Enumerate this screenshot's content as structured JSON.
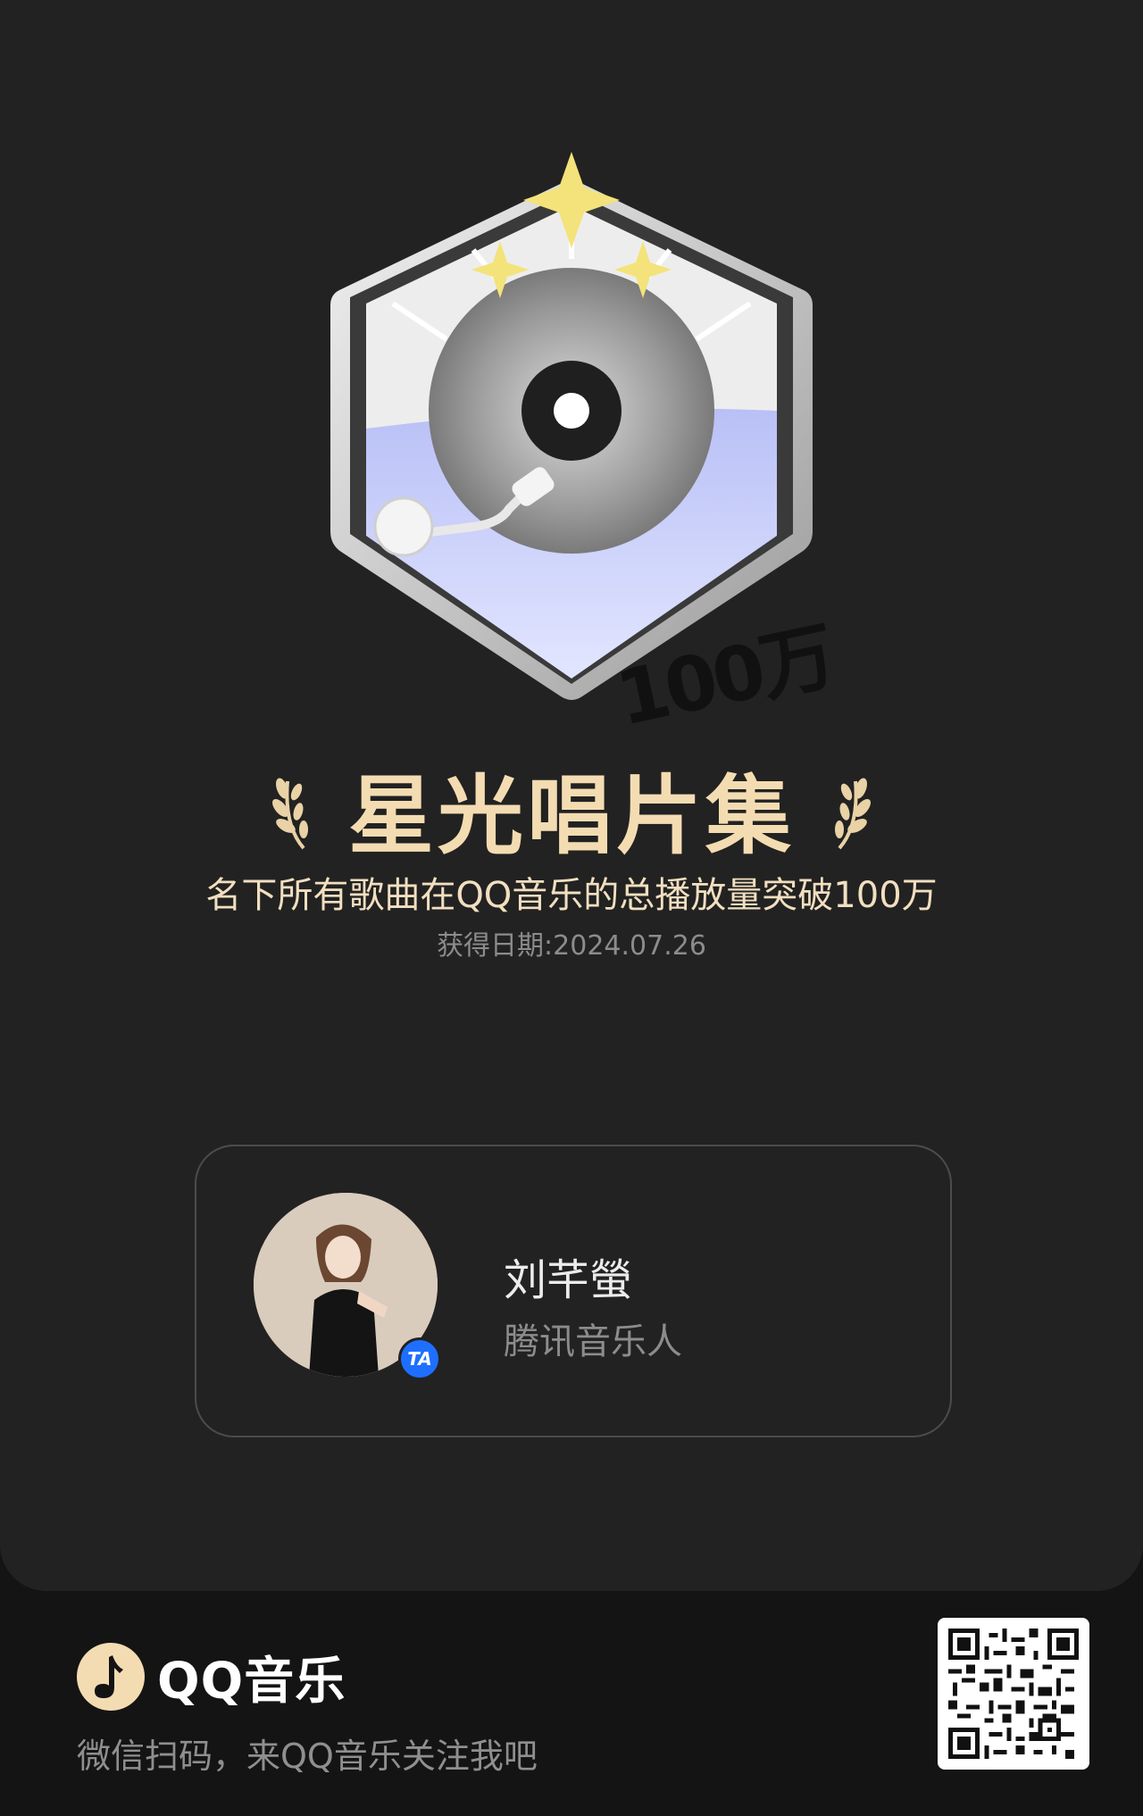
{
  "badge": {
    "number_label": "100万"
  },
  "achievement": {
    "title": "星光唱片集",
    "description": "名下所有歌曲在QQ音乐的总播放量突破100万",
    "date": "获得日期:2024.07.26"
  },
  "user": {
    "name": "刘芊螢",
    "role": "腾讯音乐人",
    "verify_label": "TA"
  },
  "footer": {
    "brand": "QQ音乐",
    "slogan": "微信扫码，来QQ音乐关注我吧"
  },
  "colors": {
    "background": "#222222",
    "footer_background": "#141414",
    "title_gold": "#f4dcb2",
    "verify_blue": "#1e6fff",
    "badge_lavender": "#c7cdfb"
  }
}
